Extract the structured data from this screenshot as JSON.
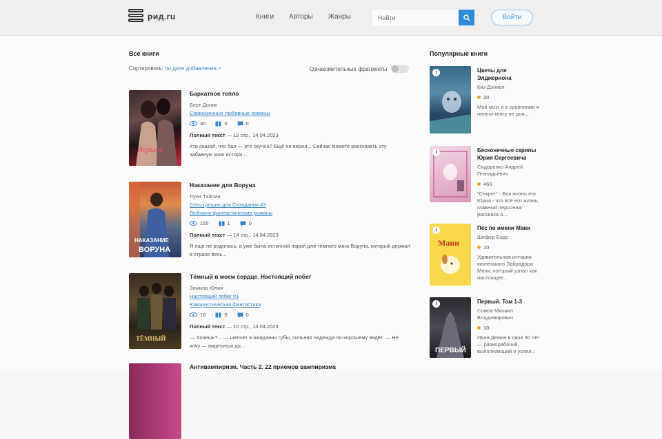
{
  "header": {
    "logo_text": "рид.ru",
    "nav": [
      "Книги",
      "Авторы",
      "Жанры"
    ],
    "search_placeholder": "Найти",
    "login_label": "Войти"
  },
  "colors": {
    "accent": "#2f8bd6",
    "link": "#3c86c9",
    "rating": "#e3a82c"
  },
  "main": {
    "title": "Все книги",
    "sort_label": "Сортировать:",
    "sort_value": "по дате добавления",
    "toggle_label": "Ознакомительные фрагменты"
  },
  "books": [
    {
      "title": "Бархатное тепло",
      "author": "Берт Доник",
      "links": [
        "Современные любовные романы"
      ],
      "views": "30",
      "pages": "0",
      "comments": "0",
      "full_label": "Полный текст",
      "full_meta": "— 12 стр., 14.04.2023",
      "desc": "Кто сказал, что бал — это скучно? Ещё не верил... Сейчас можете рассказать эту забавную мою истори..."
    },
    {
      "title": "Наказание для Воруна",
      "author": "Луна Тайлин",
      "links": [
        "Сеть трещин для Созидания #3",
        "Любовно-фантастические романы"
      ],
      "views": "155",
      "pages": "1",
      "comments": "0",
      "full_label": "Полный текст",
      "full_meta": "— 14 стр., 14.04.2023",
      "desc": "Я еще не родилась, а уже была истинной парой для темного мага Воруна, который держал в страхе весь..."
    },
    {
      "title": "Тёмный в моем сердце. Настоящий побег",
      "author": "Зимина Юлия",
      "links": [
        "Настоящий побег #1",
        "Юмористическая фантастика"
      ],
      "views": "18",
      "pages": "0",
      "comments": "0",
      "full_label": "Полный текст",
      "full_meta": "— 10 стр., 14.04.2023",
      "desc": "— Хочешь?... — шепчет в ожидании губы, сильная надежда по-хорошему ведёт. — Не хочу — видеоигра до..."
    },
    {
      "title": "Антивампиризм. Часть 2. 22 приемов вампиризма"
    }
  ],
  "popular": {
    "title": "Популярные книги",
    "items": [
      {
        "badge": "i",
        "title": "Цветы для Элджернона",
        "author": "Киз Дэниел",
        "rating": "20",
        "desc": "Мой мозг я в сравнении я ничего книгу не для..."
      },
      {
        "badge": "i",
        "title": "Бесконечные скрипы Юрия Сергеевича",
        "author": "Сидоренко Андрей Геннадьевич",
        "rating": "460",
        "desc": "\"Секрет\" - Вся жизнь его Юрия - это всё его жизнь, главный персонаж рассказа о..."
      },
      {
        "badge": "i",
        "title": "Пёс по имени Мани",
        "author": "Шефер Бодо",
        "rating": "10",
        "desc": "Удивительная история маленького Лабрадора Мани, который узнал как настоящее..."
      },
      {
        "badge": "i",
        "title": "Первый. Том 1-3",
        "author": "Сомов Михаил Владимирович",
        "rating": "10",
        "desc": "Иван Демин в свои 30 лет — разнорабочий, выполняющий и успел..."
      }
    ]
  }
}
